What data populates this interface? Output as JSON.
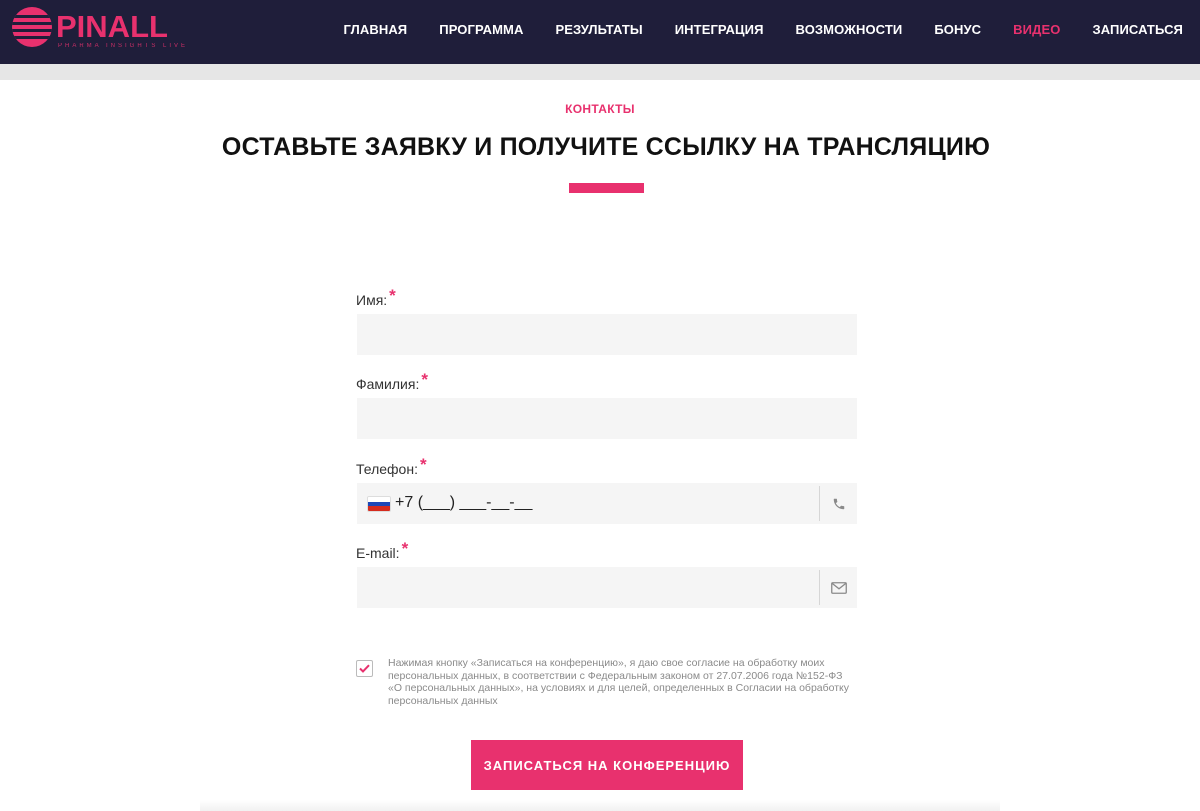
{
  "brand": {
    "name": "PINALL",
    "tagline": "PHARMA INSIGHTS LIVE",
    "accent_color": "#e8316e",
    "header_bg": "#1f1e3a"
  },
  "nav": {
    "items": [
      {
        "label": "ГЛАВНАЯ",
        "active": false
      },
      {
        "label": "ПРОГРАММА",
        "active": false
      },
      {
        "label": "РЕЗУЛЬТАТЫ",
        "active": false
      },
      {
        "label": "ИНТЕГРАЦИЯ",
        "active": false
      },
      {
        "label": "ВОЗМОЖНОСТИ",
        "active": false
      },
      {
        "label": "БОНУС",
        "active": false
      },
      {
        "label": "ВИДЕО",
        "active": true
      },
      {
        "label": "ЗАПИСАТЬСЯ",
        "active": false
      }
    ]
  },
  "section": {
    "eyebrow": "КОНТАКТЫ",
    "title": "ОСТАВЬТЕ ЗАЯВКУ И ПОЛУЧИТЕ ССЫЛКУ НА ТРАНСЛЯЦИЮ"
  },
  "form": {
    "first_name": {
      "label": "Имя:",
      "required_mark": "*",
      "value": ""
    },
    "last_name": {
      "label": "Фамилия:",
      "required_mark": "*",
      "value": ""
    },
    "phone": {
      "label": "Телефон:",
      "required_mark": "*",
      "value": "+7 (___) ___-__-__",
      "icon": "phone-icon",
      "country": "ru-flag"
    },
    "email": {
      "label": "E-mail:",
      "required_mark": "*",
      "value": "",
      "icon": "envelope-icon"
    },
    "consent": {
      "checked": true,
      "text": "Нажимая кнопку «Записаться на конференцию», я даю свое согласие на обработку моих персональных данных, в соответствии с Федеральным законом от 27.07.2006 года №152-ФЗ «О персональных данных», на условиях и для целей, определенных в Согласии на обработку персональных данных"
    },
    "submit_label": "ЗАПИСАТЬСЯ НА КОНФЕРЕНЦИЮ"
  }
}
